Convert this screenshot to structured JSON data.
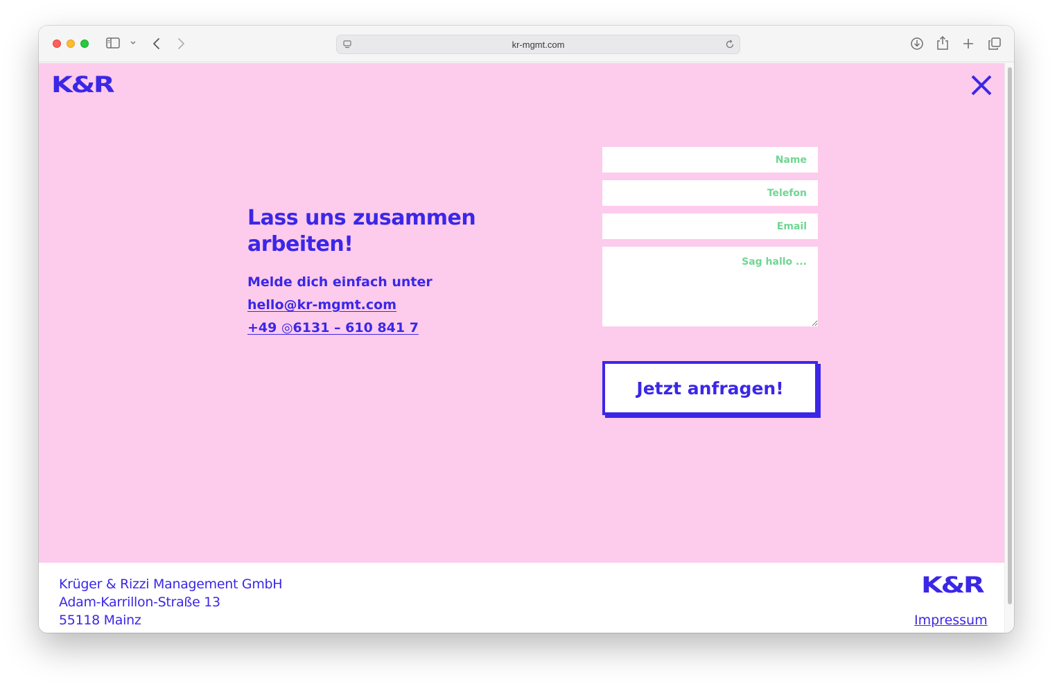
{
  "browser": {
    "url": "kr-mgmt.com"
  },
  "site": {
    "logo_text": "K&R",
    "brand_color": "#3b27e6",
    "background_color": "#fdcbec",
    "placeholder_color": "#6fd692"
  },
  "contact": {
    "headline": "Lass uns zusammen arbeiten!",
    "intro": "Melde dich einfach unter",
    "email": "hello@kr-mgmt.com",
    "phone": "+49 ◎6131 – 610 841 7"
  },
  "form": {
    "name_placeholder": "Name",
    "phone_placeholder": "Telefon",
    "email_placeholder": "Email",
    "message_placeholder": "Sag hallo ...",
    "submit_label": "Jetzt anfragen!"
  },
  "footer": {
    "company": "Krüger & Rizzi Management GmbH",
    "street": "Adam-Karrillon-Straße 13",
    "city": "55118 Mainz",
    "logo_text": "K&R",
    "impressum_label": "Impressum"
  },
  "icons": [
    "sidebar-icon",
    "chevron-down-icon",
    "back-icon",
    "forward-icon",
    "page-icon",
    "reload-icon",
    "download-icon",
    "share-icon",
    "plus-icon",
    "tabs-icon",
    "close-icon"
  ]
}
